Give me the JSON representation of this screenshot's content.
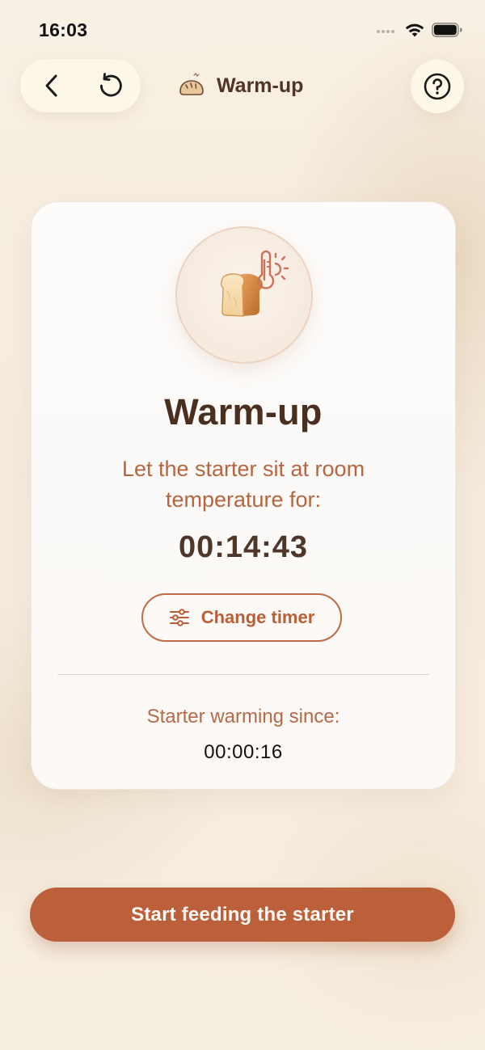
{
  "status_bar": {
    "time": "16:03"
  },
  "nav": {
    "title": "Warm-up",
    "back_icon": "chevron-left-icon",
    "reset_icon": "rotate-ccw-icon",
    "title_icon": "bread-icon",
    "help_icon": "question-circle-icon"
  },
  "card": {
    "title": "Warm-up",
    "instruction": "Let the starter sit at room temperature for:",
    "timer": "00:14:43",
    "change_timer_label": "Change timer",
    "change_timer_icon": "sliders-icon",
    "warming_since_label": "Starter warming since:",
    "warming_since_value": "00:00:16",
    "hero_icons": [
      "bread-icon",
      "thermometer-sun-icon"
    ]
  },
  "primary_action": {
    "label": "Start feeding the starter"
  },
  "colors": {
    "accent": "#bb603b",
    "title_text": "#4a2f1e",
    "instruction_text": "#b7653f",
    "background": "#f6ede0",
    "card": "#fdfcfb"
  }
}
